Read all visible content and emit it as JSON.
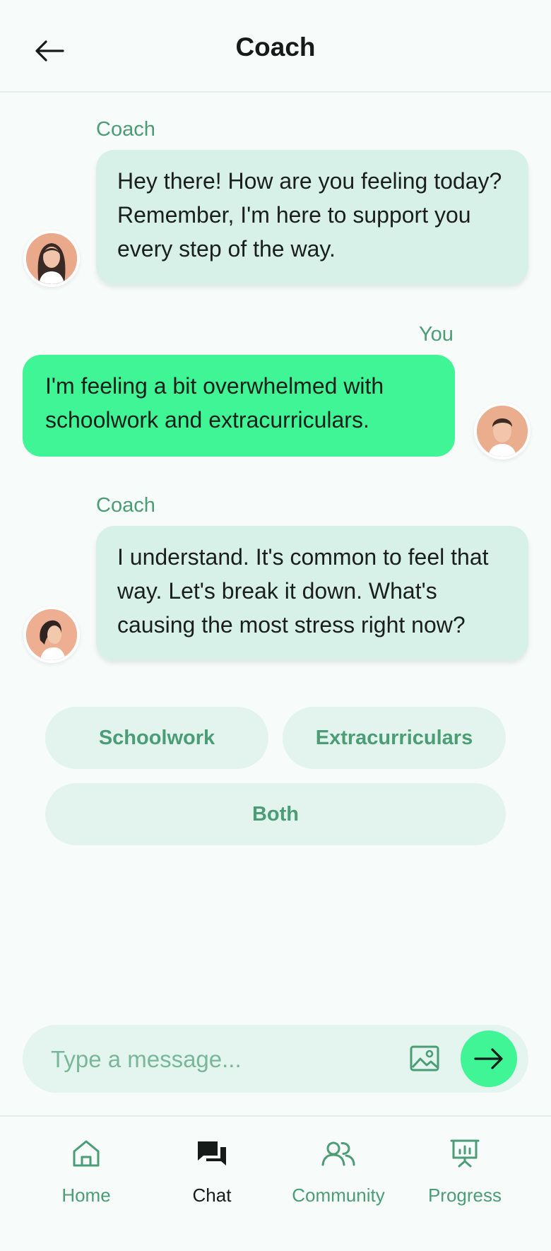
{
  "header": {
    "title": "Coach"
  },
  "messages": [
    {
      "sender": "Coach",
      "text": "Hey there! How are you feeling today? Remember, I'm here to support you every step of the way."
    },
    {
      "sender": "You",
      "text": "I'm feeling a bit overwhelmed with schoolwork and extracurriculars."
    },
    {
      "sender": "Coach",
      "text": "I understand. It's common to feel that way. Let's break it down. What's causing the most stress right now?"
    }
  ],
  "quick_replies": [
    "Schoolwork",
    "Extracurriculars",
    "Both"
  ],
  "composer": {
    "placeholder": "Type a message..."
  },
  "nav": {
    "items": [
      {
        "label": "Home",
        "icon": "home-icon"
      },
      {
        "label": "Chat",
        "icon": "chat-icon",
        "active": true
      },
      {
        "label": "Community",
        "icon": "community-icon"
      },
      {
        "label": "Progress",
        "icon": "progress-icon"
      }
    ]
  },
  "colors": {
    "accent": "#3ff596",
    "coach_bubble": "#d8f1e8",
    "muted_green": "#4a9d75",
    "background": "#f7fbfa"
  }
}
